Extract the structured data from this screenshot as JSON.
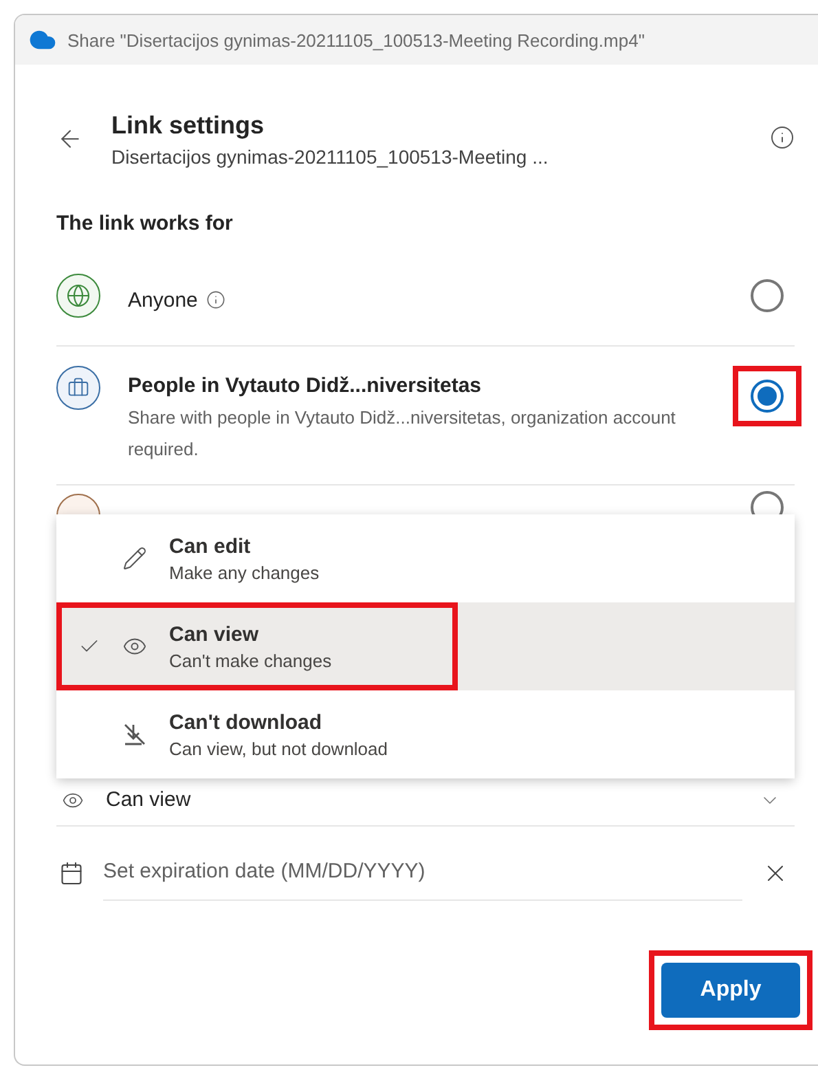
{
  "window": {
    "title": "Share \"Disertacijos gynimas-20211105_100513-Meeting Recording.mp4\""
  },
  "header": {
    "title": "Link settings",
    "subtitle": "Disertacijos gynimas-20211105_100513-Meeting ..."
  },
  "section_label": "The link works for",
  "audience_options": [
    {
      "kind": "anyone",
      "label": "Anyone",
      "selected": false,
      "highlighted": false
    },
    {
      "kind": "organization",
      "label": "People in Vytauto Didž...niversitetas",
      "description": "Share with people in Vytauto Didž...niversitetas, organization account required.",
      "selected": true,
      "highlighted": true
    },
    {
      "kind": "specific",
      "highlighted": false
    }
  ],
  "permission_menu": {
    "items": [
      {
        "kind": "edit",
        "label": "Can edit",
        "description": "Make any changes",
        "selected": false,
        "highlighted": false
      },
      {
        "kind": "view",
        "label": "Can view",
        "description": "Can't make changes",
        "selected": true,
        "highlighted": true
      },
      {
        "kind": "no_download",
        "label": "Can't download",
        "description": "Can view, but not download",
        "selected": false,
        "highlighted": false
      }
    ]
  },
  "permission": {
    "label": "Can view"
  },
  "expiration": {
    "placeholder": "Set expiration date (MM/DD/YYYY)"
  },
  "apply_button": {
    "label": "Apply",
    "highlighted": true
  }
}
